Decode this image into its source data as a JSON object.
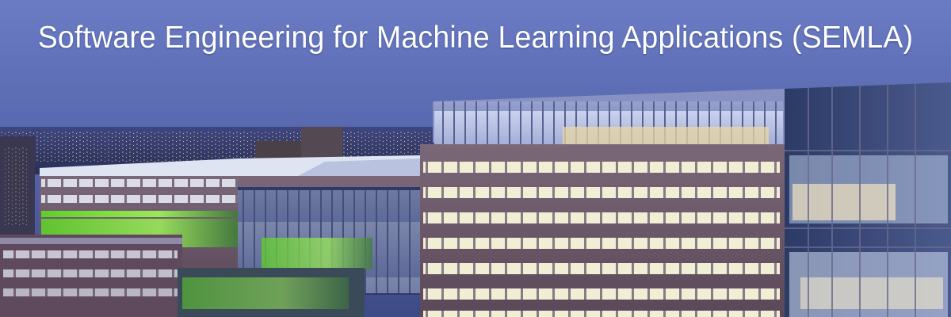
{
  "banner": {
    "title": "Software Engineering for Machine Learning Applications (SEMLA)",
    "title_color": "#ffffff",
    "sky_top_color": "#6b7bc4",
    "sky_horizon_color": "#3e4a86",
    "facade_color": "#6e5a6c",
    "window_light_color": "#f1eed6",
    "accent_green_color": "#7be03a"
  }
}
